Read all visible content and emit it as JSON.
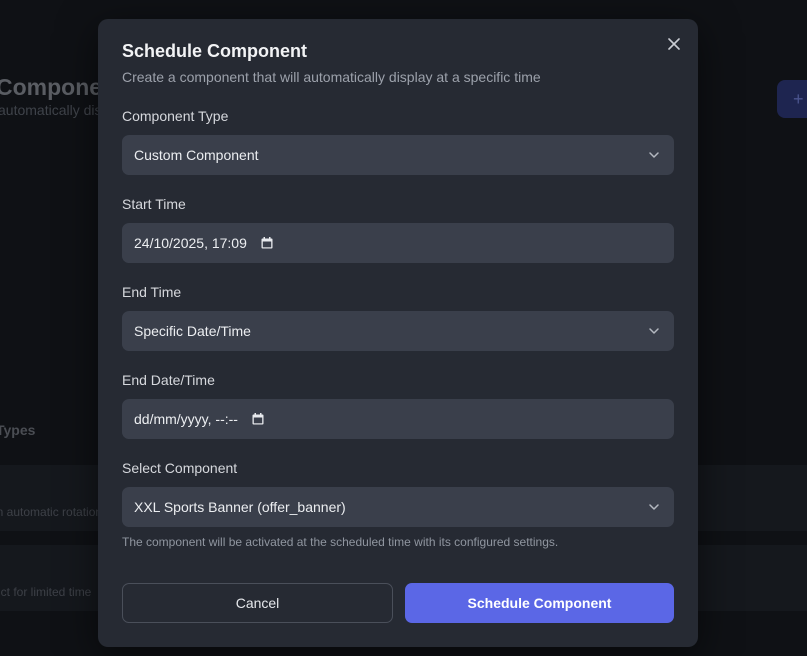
{
  "background": {
    "title": "Components",
    "subtitle": "automatically display",
    "add_button_label": "+",
    "section_title": "Types",
    "cards": [
      {
        "text": "in automatic rotation"
      },
      {
        "text": "uct for limited time"
      }
    ]
  },
  "modal": {
    "title": "Schedule Component",
    "description": "Create a component that will automatically display at a specific time",
    "fields": {
      "component_type": {
        "label": "Component Type",
        "value": "Custom Component"
      },
      "start_time": {
        "label": "Start Time",
        "value": "24/10/2025, 17:09"
      },
      "end_time": {
        "label": "End Time",
        "value": "Specific Date/Time"
      },
      "end_datetime": {
        "label": "End Date/Time",
        "placeholder": "dd/mm/yyyy, --:--"
      },
      "select_component": {
        "label": "Select Component",
        "value": "XXL Sports Banner (offer_banner)"
      }
    },
    "helper_text": "The component will be activated at the scheduled time with its configured settings.",
    "cancel_label": "Cancel",
    "submit_label": "Schedule Component"
  },
  "colors": {
    "modal_bg": "#262a33",
    "input_bg": "#3a3f4b",
    "primary": "#5b67e6"
  }
}
